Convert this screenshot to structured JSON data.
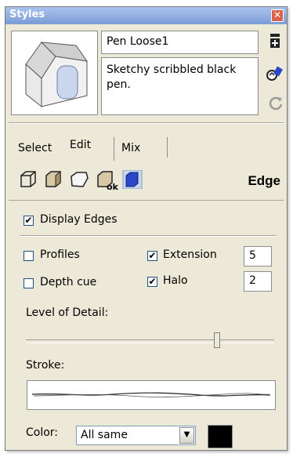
{
  "window": {
    "title": "Styles",
    "close_glyph": "✕"
  },
  "style": {
    "name": "Pen Loose1",
    "description": "Sketchy scribbled black pen."
  },
  "tabs": [
    {
      "label": "Select"
    },
    {
      "label": "Edit"
    },
    {
      "label": "Mix"
    }
  ],
  "edge_section_label": "Edge",
  "settings": {
    "display_edges": {
      "label": "Display Edges",
      "checked": true
    },
    "profiles": {
      "label": "Profiles",
      "checked": false
    },
    "depth_cue": {
      "label": "Depth cue",
      "checked": false
    },
    "extension": {
      "label": "Extension",
      "checked": true,
      "value": "5"
    },
    "halo": {
      "label": "Halo",
      "checked": true,
      "value": "2"
    },
    "level_of_detail": {
      "label": "Level of Detail:",
      "level": 0.76
    },
    "stroke_label": "Stroke:",
    "color_label": "Color:",
    "color_mode": "All same",
    "color_swatch": "#000000"
  },
  "icons": {
    "side": [
      "create-style-icon",
      "update-style-icon",
      "refresh-icon"
    ],
    "edge_tools": [
      "edge-settings-icon",
      "face-settings-icon",
      "background-settings-icon",
      "watermark-settings-icon",
      "modeling-settings-icon"
    ]
  },
  "colors": {
    "titlebar": "#8eabe0",
    "panel": "#ece9d8",
    "accent_blue": "#2a47c8"
  }
}
